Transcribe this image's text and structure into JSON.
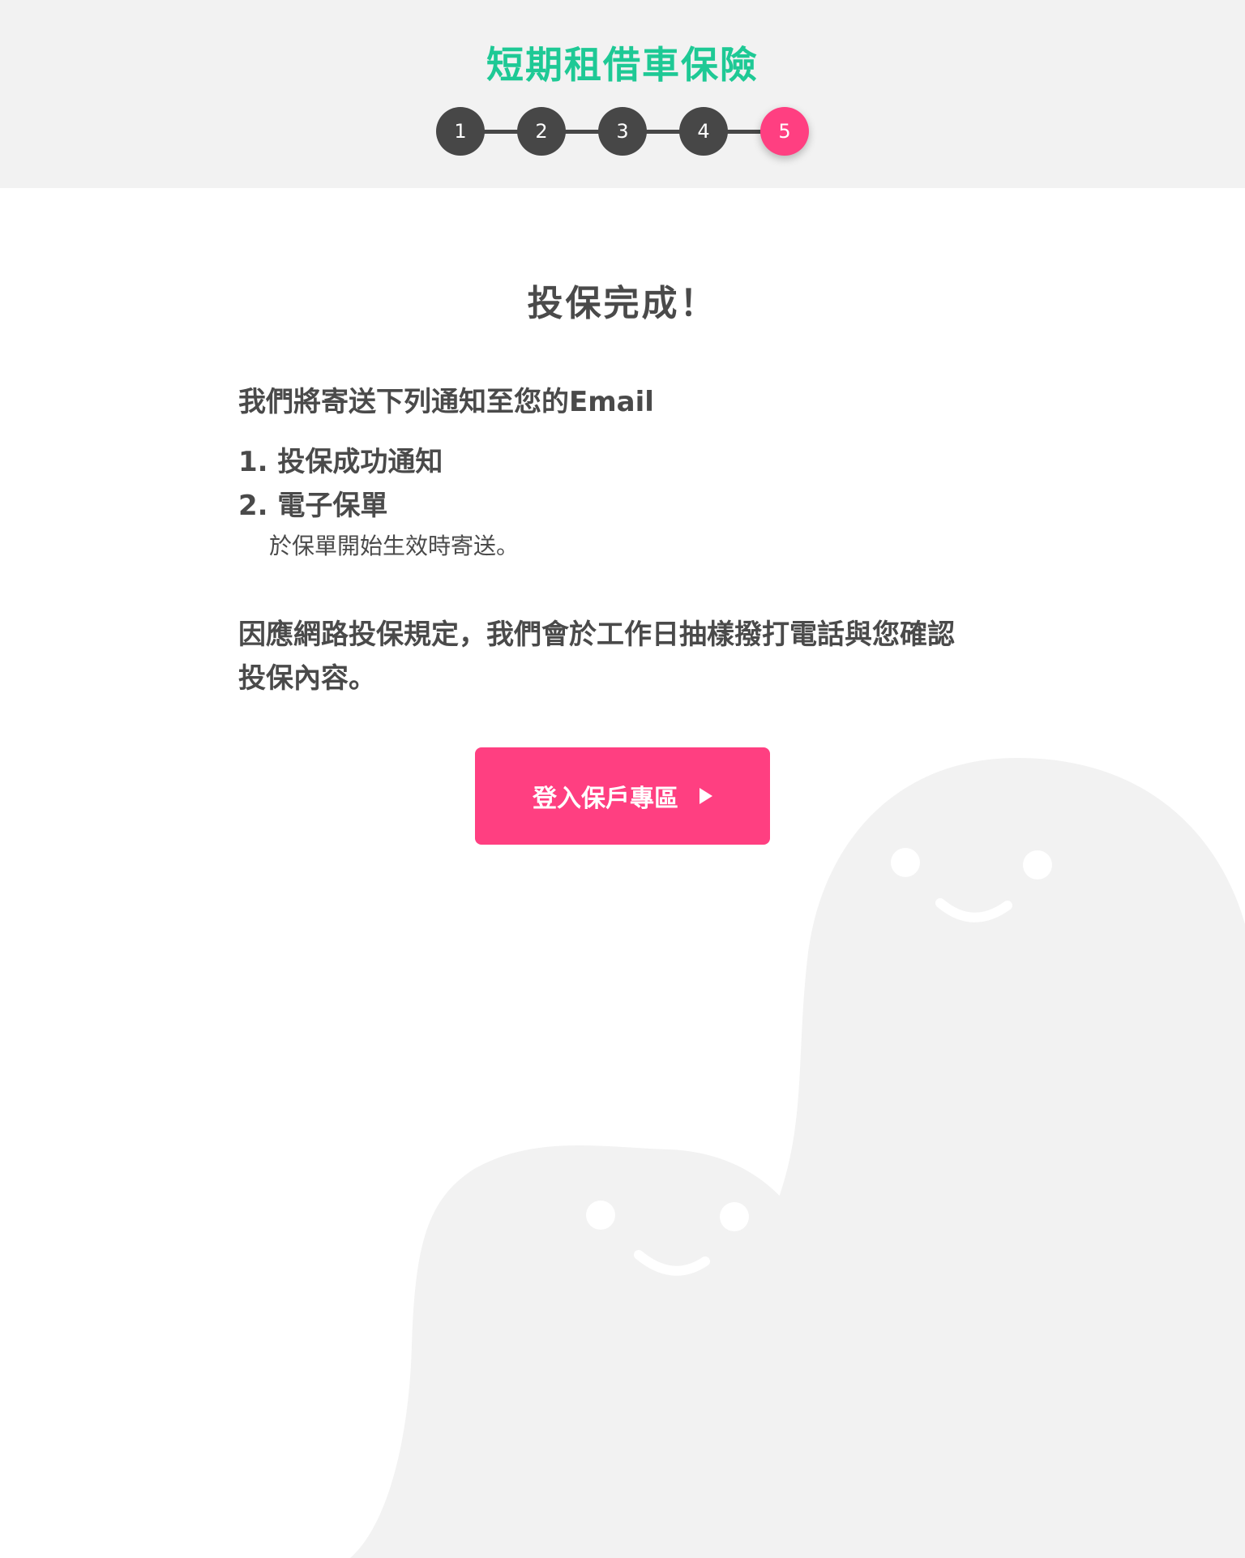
{
  "header": {
    "title": "短期租借車保險",
    "steps": [
      "1",
      "2",
      "3",
      "4",
      "5"
    ],
    "current_step": 5
  },
  "main": {
    "title": "投保完成！",
    "email_intro": "我們將寄送下列通知至您的Email",
    "notices": [
      "1. 投保成功通知",
      "2. 電子保單"
    ],
    "policy_note": "於保單開始生效時寄送。",
    "verify_line1": "因應網路投保規定，我們會於工作日抽樣撥打電話與您確認",
    "verify_line2": "投保內容。",
    "login_button": "登入保戶專區"
  },
  "colors": {
    "brand_green": "#1ec995",
    "accent_pink": "#ff3f81",
    "step_dark": "#474747",
    "header_bg": "#f2f2f2",
    "ghost": "#f2f2f2"
  },
  "icons": {
    "button_arrow": "play-arrow-icon"
  }
}
